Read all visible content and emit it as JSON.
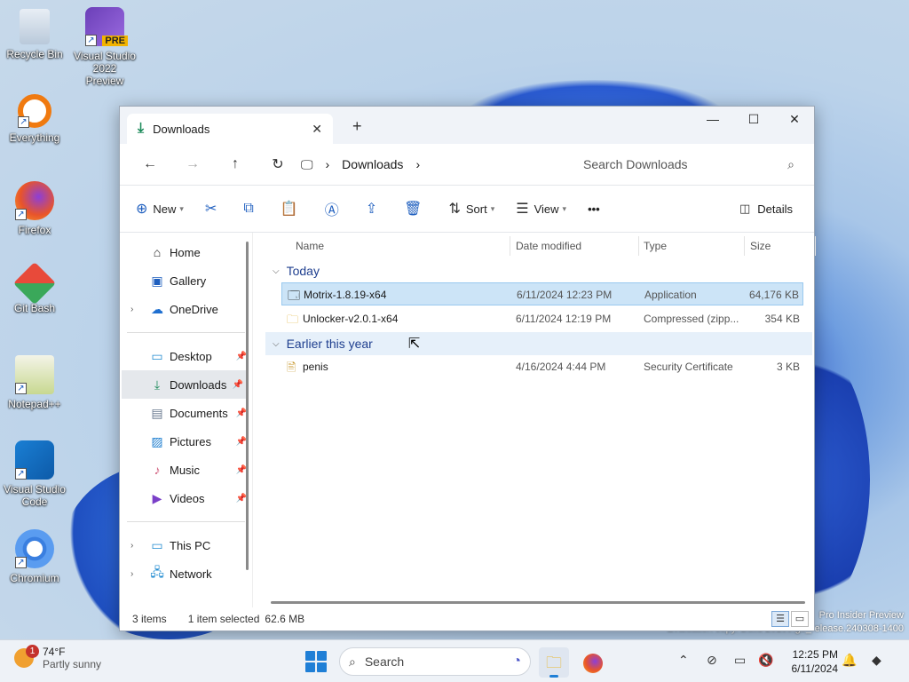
{
  "desktop": {
    "icons": [
      {
        "label": "Recycle Bin"
      },
      {
        "label": "Visual Studio 2022 Preview"
      },
      {
        "label": "Everything"
      },
      {
        "label": "Firefox"
      },
      {
        "label": "Git Bash"
      },
      {
        "label": "Notepad++"
      },
      {
        "label": "Visual Studio Code"
      },
      {
        "label": "Chromium"
      }
    ],
    "pre_badge": "PRE",
    "watermark_line1": "Pro Insider Preview",
    "watermark_line2": "Evaluation copy. Build 26100.ge_release.240308-1400"
  },
  "window": {
    "tab_title": "Downloads",
    "new_tab": "+",
    "controls": {
      "minimize": "—",
      "maximize": "☐",
      "close": "✕"
    },
    "address": {
      "crumb": "Downloads",
      "search_placeholder": "Search Downloads"
    },
    "toolbar": {
      "new_label": "New",
      "sort_label": "Sort",
      "view_label": "View",
      "more_label": "•••",
      "details_label": "Details"
    },
    "sidebar": {
      "quick": [
        {
          "label": "Home",
          "icon": "home-icon"
        },
        {
          "label": "Gallery",
          "icon": "gallery-icon"
        },
        {
          "label": "OneDrive",
          "icon": "cloud-icon"
        }
      ],
      "pinned": [
        {
          "label": "Desktop",
          "icon": "desktop-icon"
        },
        {
          "label": "Downloads",
          "icon": "download-icon",
          "selected": true
        },
        {
          "label": "Documents",
          "icon": "documents-icon"
        },
        {
          "label": "Pictures",
          "icon": "pictures-icon"
        },
        {
          "label": "Music",
          "icon": "music-icon"
        },
        {
          "label": "Videos",
          "icon": "videos-icon"
        }
      ],
      "drives": [
        {
          "label": "This PC",
          "icon": "pc-icon"
        },
        {
          "label": "Network",
          "icon": "network-icon"
        }
      ]
    },
    "columns": {
      "name": "Name",
      "date": "Date modified",
      "type": "Type",
      "size": "Size"
    },
    "groups": [
      {
        "label": "Today",
        "files": [
          {
            "name": "Motrix-1.8.19-x64",
            "date": "6/11/2024 12:23 PM",
            "type": "Application",
            "size": "64,176 KB",
            "selected": true
          },
          {
            "name": "Unlocker-v2.0.1-x64",
            "date": "6/11/2024 12:19 PM",
            "type": "Compressed (zipp...",
            "size": "354 KB"
          }
        ]
      },
      {
        "label": "Earlier this year",
        "files": [
          {
            "name": "penis",
            "date": "4/16/2024 4:44 PM",
            "type": "Security Certificate",
            "size": "3 KB"
          }
        ]
      }
    ],
    "status": {
      "count": "3 items",
      "selected": "1 item selected",
      "size": "62.6 MB"
    }
  },
  "taskbar": {
    "weather_temp": "74°F",
    "weather_desc": "Partly sunny",
    "weather_badge": "1",
    "search_label": "Search",
    "time": "12:25 PM",
    "date": "6/11/2024"
  }
}
